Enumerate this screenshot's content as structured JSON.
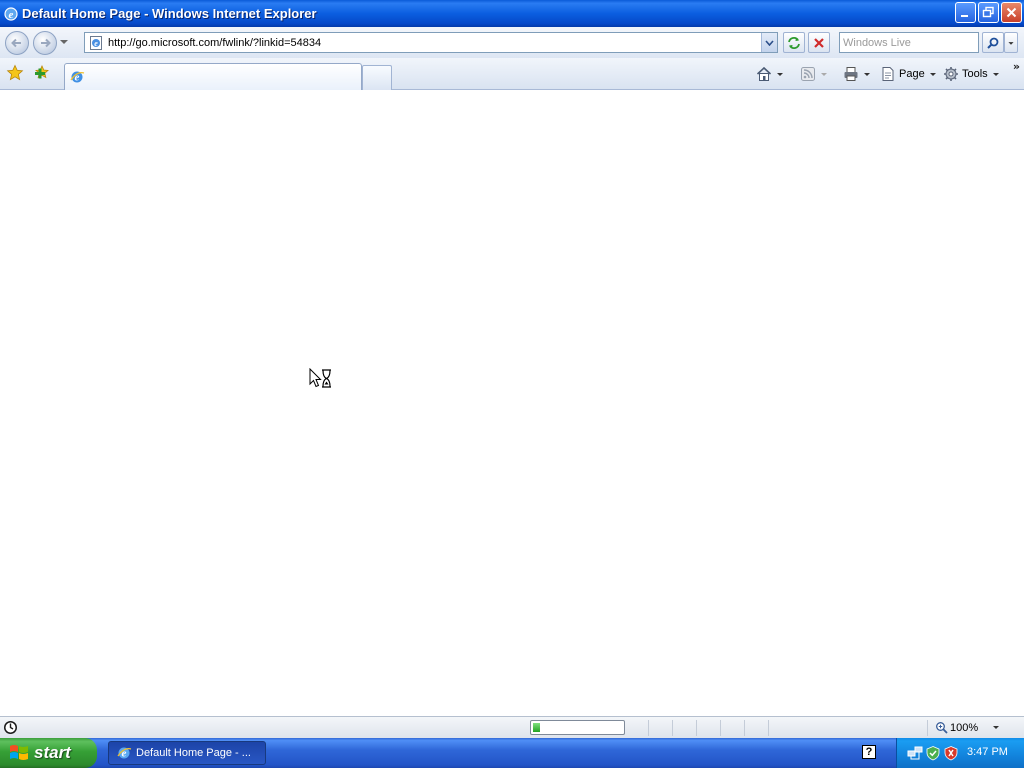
{
  "window": {
    "title": "Default Home Page - Windows Internet Explorer"
  },
  "address_bar": {
    "url": "http://go.microsoft.com/fwlink/?linkid=54834"
  },
  "search": {
    "placeholder": "Windows Live"
  },
  "tabs": [
    {
      "label": ""
    }
  ],
  "command_bar": {
    "page_label": "Page",
    "tools_label": "Tools",
    "overflow_label": "»"
  },
  "status_bar": {
    "progress_fraction": 0.08,
    "zoom_label": "100%"
  },
  "taskbar": {
    "start_label": "start",
    "task_item_label": "Default Home Page - ...",
    "help_label": "?",
    "clock": "3:47 PM"
  },
  "colors": {
    "titlebar_blue": "#0b5ee0",
    "taskbar_blue": "#2f67d8",
    "start_green": "#36a036",
    "tray_blue": "#1283dc",
    "progress_green": "#22a322"
  },
  "icons": {
    "title": "ie-logo-icon",
    "back": "back-arrow-icon",
    "forward": "forward-arrow-icon",
    "refresh": "refresh-icon",
    "stop": "stop-icon",
    "search": "magnifier-icon",
    "favorites": "favorites-star-icon",
    "add_favorite": "add-favorites-icon",
    "home": "home-icon",
    "feeds": "rss-feed-icon",
    "print": "printer-icon",
    "page": "page-icon",
    "tools": "gear-icon",
    "status": "loading-icon",
    "zoom": "zoom-icon",
    "cursor": "busy-cursor-icon"
  }
}
